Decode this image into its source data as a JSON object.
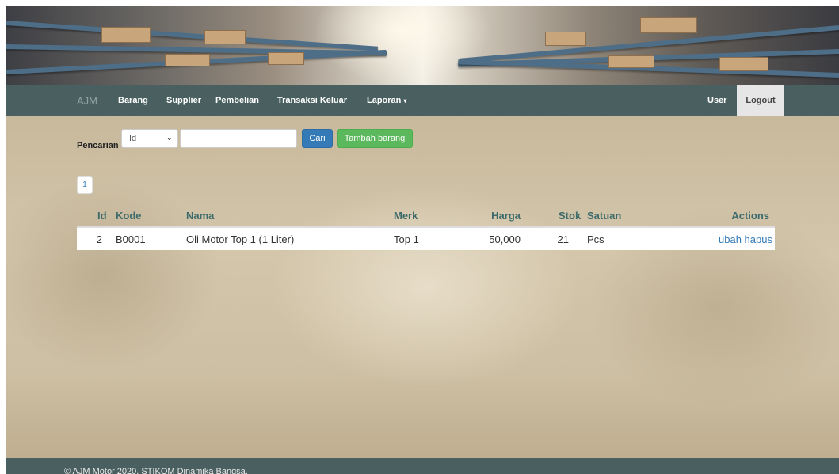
{
  "navbar": {
    "brand": "AJM",
    "items": [
      {
        "label": "Barang"
      },
      {
        "label": "Supplier"
      },
      {
        "label": "Pembelian"
      },
      {
        "label": "Transaksi Keluar"
      },
      {
        "label": "Laporan"
      }
    ],
    "laporan_caret": "▾",
    "user_label": "User",
    "logout_label": "Logout"
  },
  "search": {
    "label": "Pencarian",
    "select_value": "Id",
    "input_value": "",
    "input_placeholder": "",
    "cari_label": "Cari",
    "tambah_label": "Tambah barang"
  },
  "pagination": {
    "current_page": "1"
  },
  "table": {
    "columns": [
      "Id",
      "Kode",
      "Nama",
      "Merk",
      "Harga",
      "Stok",
      "Satuan",
      "Actions"
    ],
    "rows": [
      {
        "id": "2",
        "kode": "B0001",
        "nama": "Oli Motor Top 1 (1 Liter)",
        "merk": "Top 1",
        "harga": "50,000",
        "stok": "21",
        "satuan": "Pcs",
        "edit_label": "ubah",
        "delete_label": "hapus"
      }
    ]
  },
  "footer": {
    "text": "© AJM Motor 2020. STIKOM Dinamika Bangsa."
  },
  "colors": {
    "navbar_bg": "#4a6060",
    "header_text": "#3d6a6a",
    "link": "#337ab7",
    "primary_button": "#337ab7",
    "success_button": "#5cb85c"
  }
}
